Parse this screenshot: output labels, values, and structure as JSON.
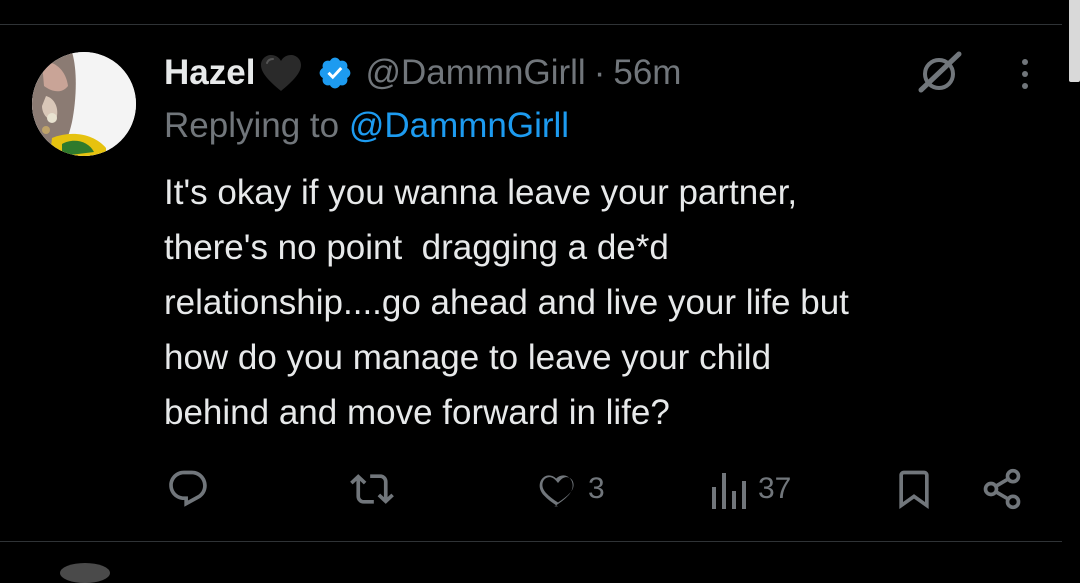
{
  "tweet": {
    "display_name": "Hazel",
    "name_emoji": "black-heart-emoji",
    "verified": true,
    "handle": "@DammnGirll",
    "separator": "·",
    "time": "56m",
    "replying_prefix": "Replying to ",
    "replying_to": "@DammnGirll",
    "body_lines": [
      "It's okay if you wanna leave your partner,",
      "there's no point  dragging a de*d",
      "relationship....go ahead and live your life but",
      "how do you manage to leave your child",
      "behind and move forward in life?"
    ],
    "actions": {
      "reply_count": "",
      "retweet_count": "",
      "like_count": "3",
      "views_count": "37"
    }
  },
  "colors": {
    "background": "#000000",
    "text_primary": "#e7e9ea",
    "text_secondary": "#71767b",
    "accent": "#1d9bf0",
    "divider": "#2f3336"
  },
  "icons": [
    "grok-icon",
    "more-options-icon",
    "reply-icon",
    "retweet-icon",
    "like-icon",
    "views-icon",
    "bookmark-icon",
    "share-icon",
    "verified-badge-icon"
  ]
}
